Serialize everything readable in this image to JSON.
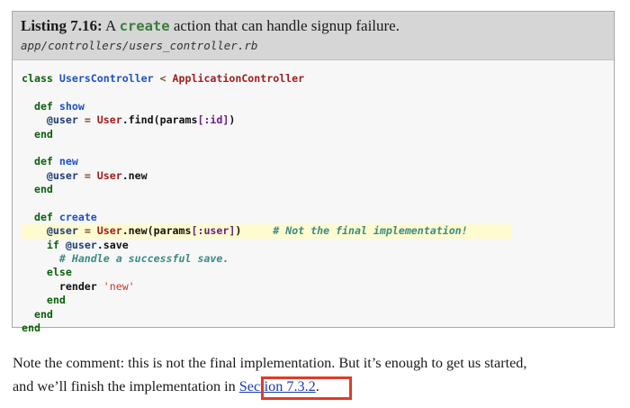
{
  "listing": {
    "label": "Listing 7.16:",
    "caption_pre": "A",
    "caption_code": "create",
    "caption_post": "action that can handle signup failure.",
    "filename": "app/controllers/users_controller.rb"
  },
  "code": {
    "l1_kw": "class",
    "l1_cls": "UsersController",
    "l1_op": "<",
    "l1_const": "ApplicationController",
    "l3_kw": "def",
    "l3_name": "show",
    "l4_ivar": "@user",
    "l4_eq": "=",
    "l4_const": "User",
    "l4_call": ".find(params",
    "l4_sym": "[:id]",
    "l4_close": ")",
    "l5_kw": "end",
    "l7_kw": "def",
    "l7_name": "new",
    "l8_ivar": "@user",
    "l8_eq": "=",
    "l8_const": "User",
    "l8_call": ".new",
    "l9_kw": "end",
    "l11_kw": "def",
    "l11_name": "create",
    "l12_ivar": "@user",
    "l12_eq": "=",
    "l12_const": "User",
    "l12_call": ".new(params",
    "l12_sym": "[:user]",
    "l12_close": ")",
    "l12_cmt": "# Not the final implementation!",
    "l13_kw": "if",
    "l13_ivar": "@user",
    "l13_call": ".save",
    "l14_cmt": "# Handle a successful save.",
    "l15_kw": "else",
    "l16_call": "render",
    "l16_str": "'new'",
    "l17_kw": "end",
    "l18_kw": "end",
    "l19_kw": "end"
  },
  "paragraph": {
    "line1": "Note the comment: this is not the final implementation.  But it’s enough to get us started,",
    "line2_pre": "and we’ll finish the implementation in",
    "link": "Section 7.3.2",
    "line2_post": "."
  },
  "colors": {
    "callout": "#e23a2a",
    "highlight": "#fdfbcf",
    "link": "#1a3cb0"
  }
}
